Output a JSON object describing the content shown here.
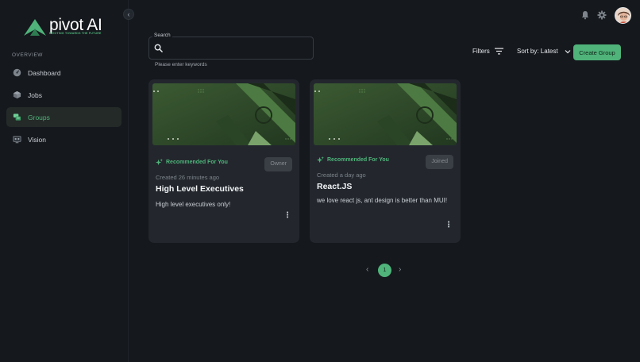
{
  "brand": {
    "name": "pivot AI",
    "tagline": "PIVOTING TOWARDS THE FUTURE",
    "accent_color": "#4fb37a"
  },
  "sidebar": {
    "section_label": "OVERVIEW",
    "items": [
      {
        "label": "Dashboard",
        "icon": "dashboard-icon",
        "active": false
      },
      {
        "label": "Jobs",
        "icon": "jobs-icon",
        "active": false
      },
      {
        "label": "Groups",
        "icon": "groups-icon",
        "active": true
      },
      {
        "label": "Vision",
        "icon": "vision-icon",
        "active": false
      }
    ]
  },
  "search": {
    "label": "Search",
    "value": "",
    "placeholder": "",
    "helper_text": "Please enter keywords"
  },
  "toolbar": {
    "filters_label": "Filters",
    "sort_label": "Sort by: Latest",
    "create_label": "Create Group"
  },
  "cards": [
    {
      "recommended_label": "Recommended For You",
      "role": "Owner",
      "created": "Created 26 minutes ago",
      "title": "High Level Executives",
      "description": "High level executives only!"
    },
    {
      "recommended_label": "Recommended For You",
      "role": "Joined",
      "created": "Created a day ago",
      "title": "React.JS",
      "description": "we love react js, ant design is better than MUI!"
    }
  ],
  "pagination": {
    "current_page": "1",
    "prev_icon": "chevron-left-icon",
    "next_icon": "chevron-right-icon"
  }
}
